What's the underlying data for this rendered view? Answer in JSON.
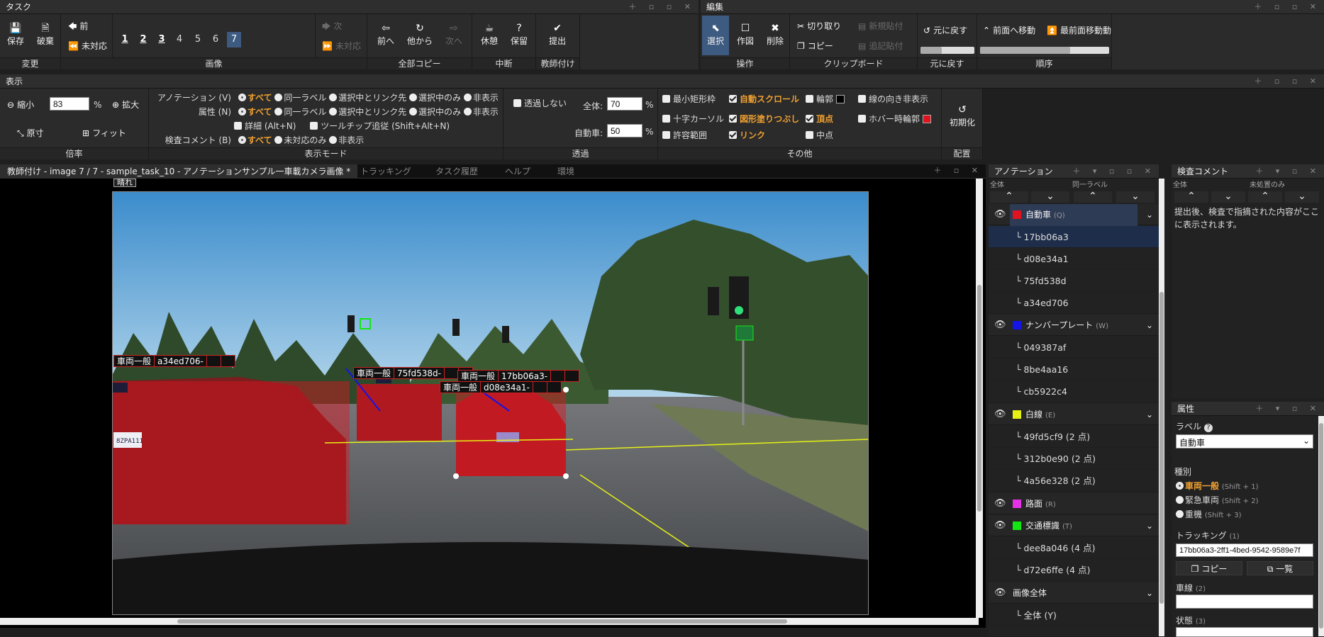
{
  "panels": {
    "task": "タスク",
    "edit": "編集",
    "view": "表示",
    "annotation": "アノテーション",
    "inspection": "検査コメント",
    "attributes": "属性"
  },
  "task": {
    "change": {
      "label": "変更",
      "save": "保存",
      "discard": "破棄"
    },
    "image": {
      "label": "画像",
      "prev": "前",
      "unanswered": "未対応",
      "pages": [
        "1",
        "2",
        "3",
        "4",
        "5",
        "6",
        "7"
      ],
      "next": "次",
      "next_unanswered": "未対応"
    },
    "copy_all": {
      "label": "全部コピー",
      "prev": "前へ",
      "other": "他から",
      "next": "次へ"
    },
    "interrupt": {
      "label": "中断",
      "rest": "休憩",
      "hold": "保留"
    },
    "teacher": {
      "label": "教師付け",
      "submit": "提出"
    }
  },
  "edit": {
    "operation": {
      "label": "操作",
      "select": "選択",
      "draw": "作図",
      "delete": "削除"
    },
    "clipboard": {
      "label": "クリップボード",
      "cut": "切り取り",
      "copy": "コピー",
      "new_paste": "新規貼付",
      "add_paste": "追記貼付"
    },
    "undo": {
      "label": "元に戻す",
      "btn": "元に戻す"
    },
    "order": {
      "label": "順序",
      "front": "前面へ移動",
      "front_most": "最前面移動動"
    }
  },
  "view": {
    "zoom": {
      "label": "倍率",
      "out": "縮小",
      "value": "83",
      "pct": "%",
      "in": "拡大",
      "orig": "原寸",
      "fit": "フィット"
    },
    "mode": {
      "label": "表示モード",
      "ann": "アノテーション (V)",
      "attr": "属性 (N)",
      "insp": "検査コメント (B)",
      "all": "すべて",
      "same": "同一ラベル",
      "link": "選択中とリンク先",
      "selonly": "選択中のみ",
      "hide": "非表示",
      "detail": "詳細 (Alt+N)",
      "tooltip": "ツールチップ追従 (Shift+Alt+N)",
      "unanswered_only": "未対応のみ"
    },
    "transparency": {
      "label": "透過",
      "none": "透過しない",
      "all_label": "全体:",
      "all_value": "70",
      "car_label": "自動車:",
      "car_value": "50",
      "pct": "%"
    },
    "other": {
      "label": "その他",
      "minrect": "最小矩形枠",
      "autoscroll": "自動スクロール",
      "outline": "輪郭",
      "line_dir": "線の向き非表示",
      "cross": "十字カーソル",
      "fill": "図形塗りつぶし",
      "vertex": "頂点",
      "hover": "ホバー時輪郭",
      "tolerance": "許容範囲",
      "link": "リンク",
      "midpoint": "中点"
    },
    "layout": {
      "label": "配置",
      "reset": "初期化"
    }
  },
  "tabs": [
    "教師付け - image 7 / 7 - sample_task_10 - アノテーションサンプル一車載カメラ画像 *",
    "トラッキング",
    "タスク履歴",
    "ヘルプ",
    "環境"
  ],
  "canvas": {
    "top_label": "晴れ",
    "labels": [
      {
        "cat": "車両一般",
        "id": "a34ed706-"
      },
      {
        "cat": "車両一般",
        "id": "75fd538d-"
      },
      {
        "cat": "車両一般",
        "id": "17bb06a3-"
      },
      {
        "cat": "車両一般",
        "id": "d08e34a1-"
      }
    ],
    "plate": "8ZPA111"
  },
  "annotation": {
    "hdr_all": "全体",
    "hdr_same": "同一ラベル",
    "cats": [
      {
        "name": "自動車",
        "shortcut": "(Q)",
        "color": "#e0141e",
        "items": [
          "17bb06a3",
          "d08e34a1",
          "75fd538d",
          "a34ed706"
        ]
      },
      {
        "name": "ナンバープレート",
        "shortcut": "(W)",
        "color": "#1414e6",
        "items": [
          "049387af",
          "8be4aa16",
          "cb5922c4"
        ]
      },
      {
        "name": "白線",
        "shortcut": "(E)",
        "color": "#e6f014",
        "items": [
          "49fd5cf9 (2 点)",
          "312b0e90 (2 点)",
          "4a56e328 (2 点)"
        ]
      },
      {
        "name": "路面",
        "shortcut": "(R)",
        "color": "#e632e6",
        "items": []
      },
      {
        "name": "交通標識",
        "shortcut": "(T)",
        "color": "#14e614",
        "items": [
          "dee8a046 (4 点)",
          "d72e6ffe (4 点)"
        ]
      },
      {
        "name": "画像全体",
        "shortcut": "",
        "color": "",
        "items": [
          "全体 (Y)"
        ]
      }
    ]
  },
  "inspection": {
    "hdr_all": "全体",
    "hdr_unanswered": "未処置のみ",
    "message": "提出後、検査で指摘された内容がここに表示されます。"
  },
  "attributes": {
    "label_title": "ラベル",
    "label_value": "自動車",
    "kind_title": "種別",
    "kinds": [
      {
        "name": "車両一般",
        "sc": "(Shift + 1)"
      },
      {
        "name": "緊急車両",
        "sc": "(Shift + 2)"
      },
      {
        "name": "重機",
        "sc": "(Shift + 3)"
      }
    ],
    "tracking_title": "トラッキング",
    "tracking_idx": "(1)",
    "tracking_value": "17bb06a3-2ff1-4bed-9542-9589e7f",
    "copy": "コピー",
    "list": "一覧",
    "lane_title": "車線",
    "lane_idx": "(2)",
    "state_title": "状態",
    "state_idx": "(3)"
  },
  "colors": {
    "accent": "#f0a030",
    "selected": "#3d5a80",
    "car": "#e0141e"
  }
}
